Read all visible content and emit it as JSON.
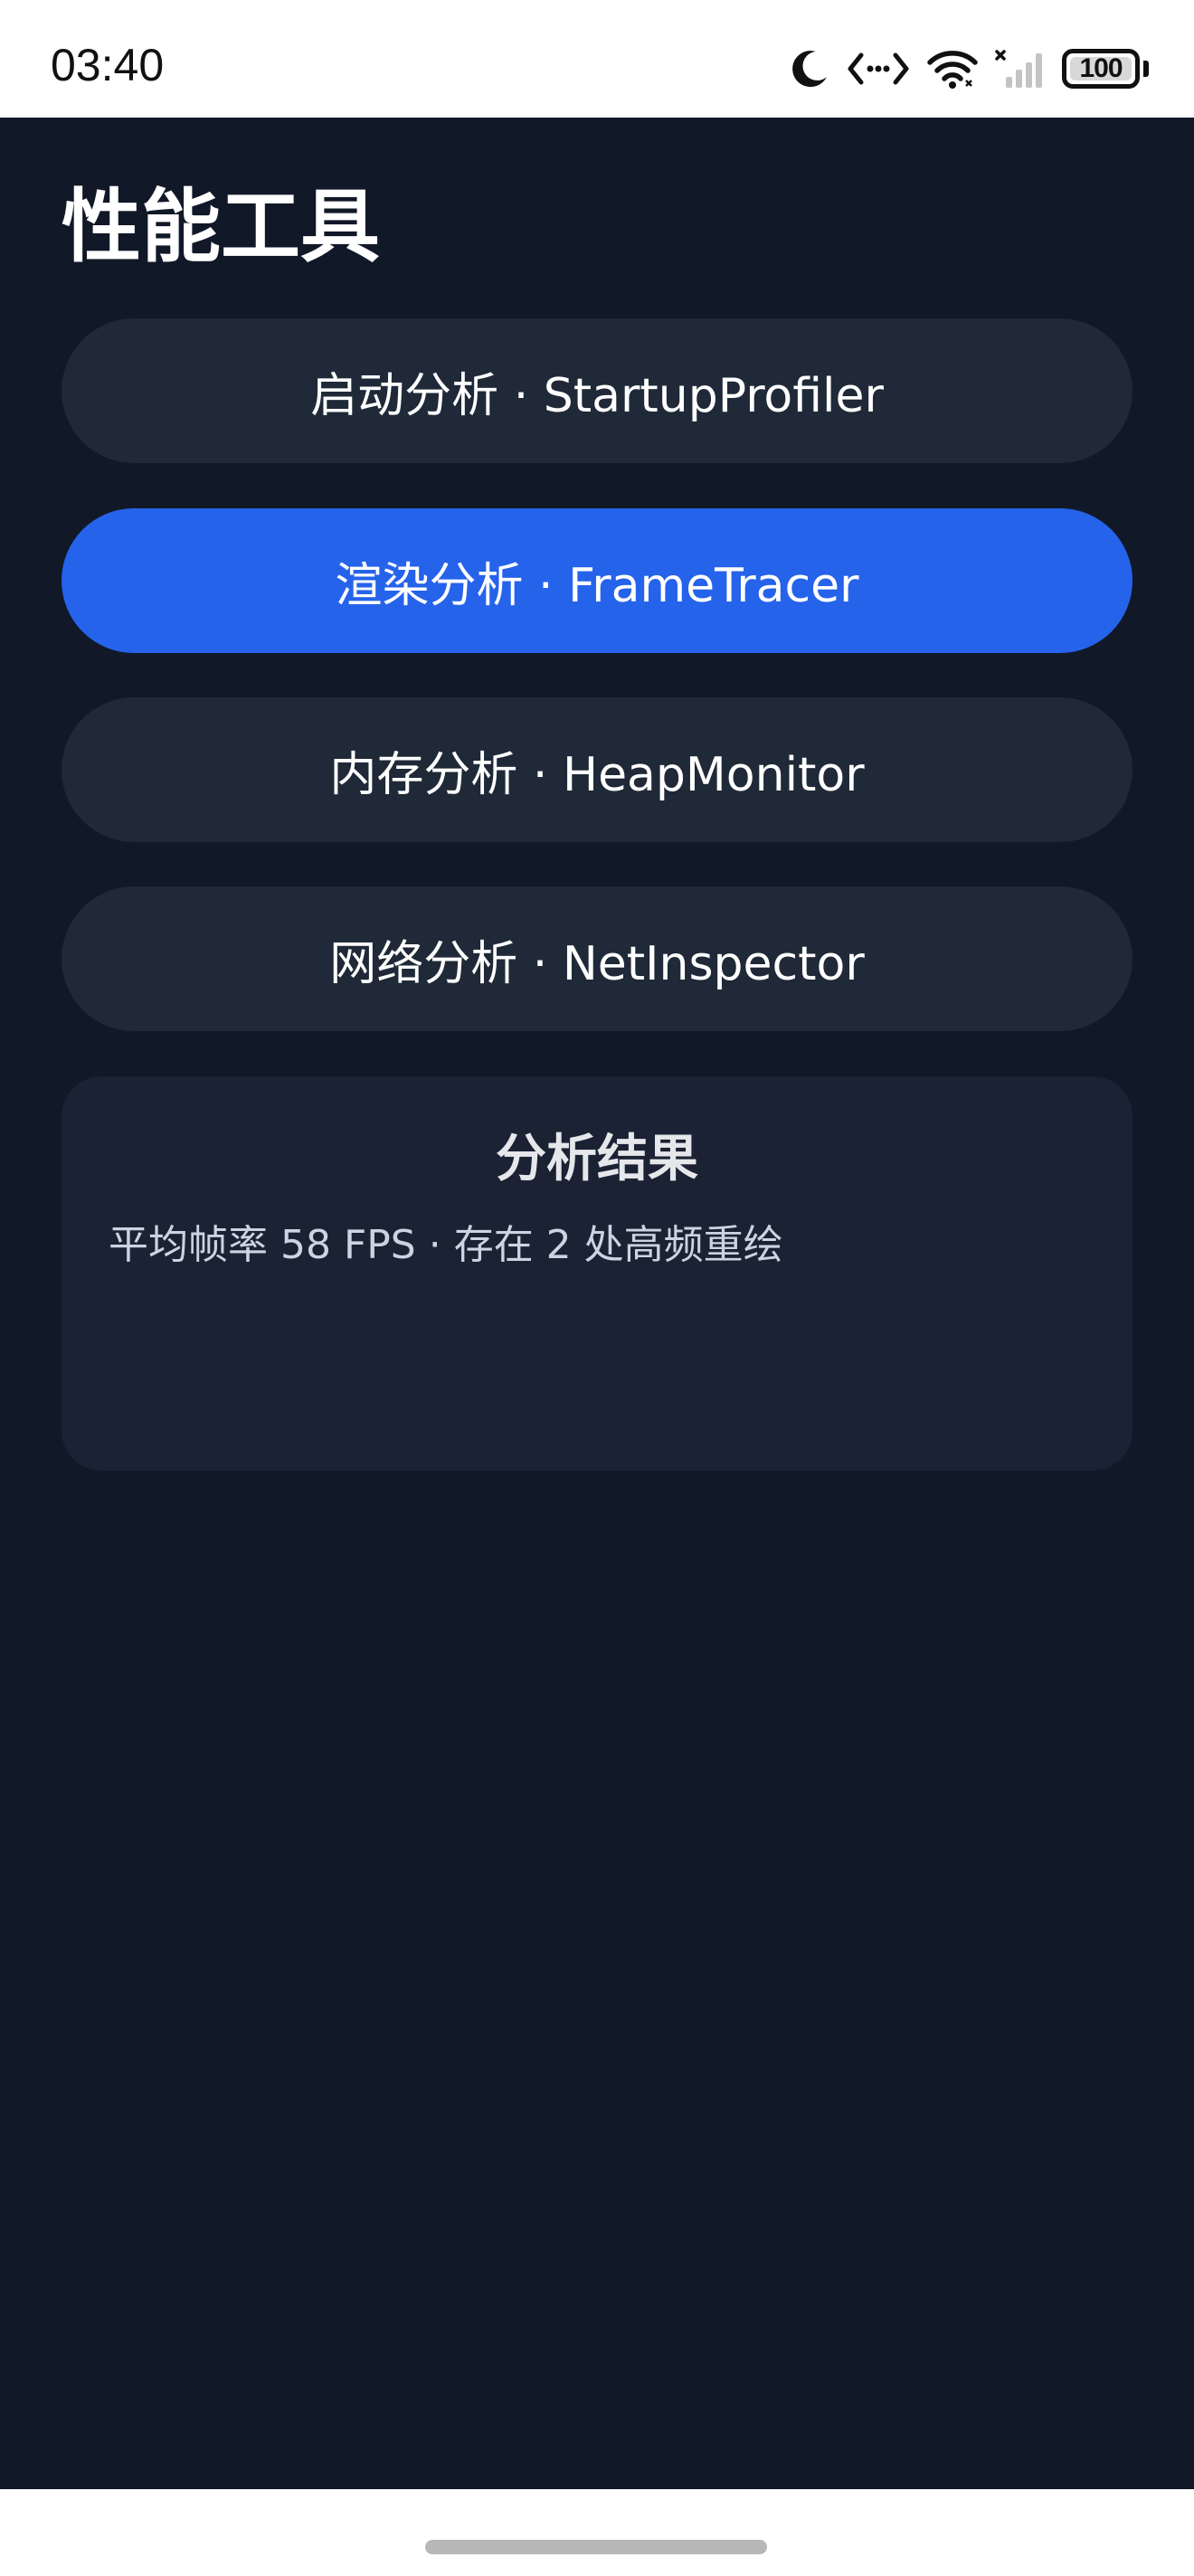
{
  "status_bar": {
    "time": "03:40",
    "battery_level": "100",
    "icons": [
      "moon-icon",
      "code-icon",
      "wifi-icon",
      "signal-icon",
      "battery-icon"
    ]
  },
  "page": {
    "title": "性能工具"
  },
  "tools": [
    {
      "label": "启动分析 · StartupProfiler",
      "selected": false
    },
    {
      "label": "渲染分析 · FrameTracer",
      "selected": true
    },
    {
      "label": "内存分析 · HeapMonitor",
      "selected": false
    },
    {
      "label": "网络分析 · NetInspector",
      "selected": false
    }
  ],
  "results": {
    "title": "分析结果",
    "text": "平均帧率 58 FPS · 存在 2 处高频重绘"
  },
  "colors": {
    "background": "#111827",
    "button": "#1f2937",
    "accent": "#2563eb",
    "card": "#1a2233"
  }
}
